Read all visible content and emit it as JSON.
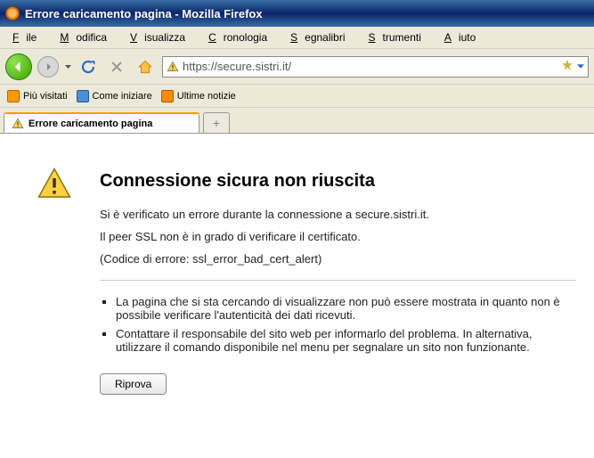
{
  "window": {
    "title": "Errore caricamento pagina - Mozilla Firefox"
  },
  "menu": {
    "file": "File",
    "edit": "Modifica",
    "view": "Visualizza",
    "history": "Cronologia",
    "bookmarks": "Segnalibri",
    "tools": "Strumenti",
    "help": "Aiuto"
  },
  "url": {
    "value": "https://secure.sistri.it/"
  },
  "bookmarks": {
    "most_visited": "Più visitati",
    "getting_started": "Come iniziare",
    "latest_news": "Ultime notizie"
  },
  "tabs": {
    "active": "Errore caricamento pagina",
    "new": "+"
  },
  "error": {
    "heading": "Connessione sicura non riuscita",
    "line1": "Si è verificato un errore durante la connessione a secure.sistri.it.",
    "line2": "Il peer SSL non è in grado di verificare il certificato.",
    "line3": "(Codice di errore: ssl_error_bad_cert_alert)",
    "bullet1": "La pagina che si sta cercando di visualizzare non può essere mostrata in quanto non è possibile verificare l'autenticità dei dati ricevuti.",
    "bullet2": "Contattare il responsabile del sito web per informarlo del problema. In alternativa, utilizzare il comando disponibile nel menu per segnalare un sito non funzionante.",
    "retry": "Riprova"
  }
}
